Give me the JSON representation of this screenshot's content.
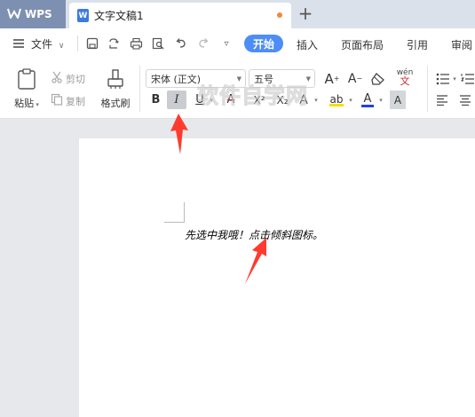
{
  "tabs": {
    "app_label": "WPS",
    "document_tab": "文字文稿1",
    "new_tab_symbol": "+"
  },
  "menu": {
    "file_label": "文件",
    "items": [
      "开始",
      "插入",
      "页面布局",
      "引用",
      "审阅"
    ]
  },
  "ribbon": {
    "paste_label": "粘贴",
    "cut_label": "剪切",
    "copy_label": "复制",
    "format_painter_label": "格式刷",
    "font_name": "宋体 (正文)",
    "font_size": "五号",
    "bold_glyph": "B",
    "italic_glyph": "I",
    "underline_glyph": "U",
    "strike_glyph": "A",
    "superscript_glyph": "X²",
    "subscript_glyph": "X₂",
    "font_color_glyph": "A",
    "char_shade_glyph": "A",
    "phonetic_glyph": "wén",
    "italic_active": true
  },
  "watermark": "软件自学网",
  "document": {
    "body_text": "先选中我哦！点击倾斜图标。"
  },
  "colors": {
    "accent": "#4e8df5",
    "tab_active": "#7d90b2",
    "modified_dot": "#f08a3a",
    "arrow": "#ff3b30",
    "highlight": "#f5e000",
    "font_color_bar": "#2041e0"
  }
}
